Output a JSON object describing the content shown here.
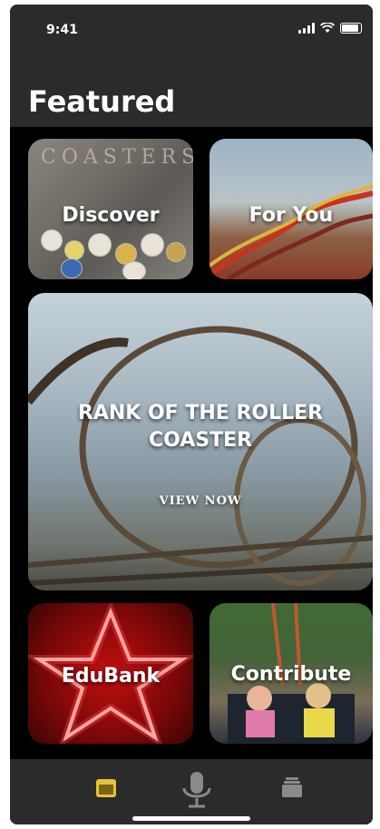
{
  "status_bar": {
    "time": "9:41"
  },
  "header": {
    "title": "Featured"
  },
  "tiles": {
    "discover": {
      "label": "Discover",
      "background_word": "COASTERS"
    },
    "for_you": {
      "label": "For You"
    },
    "rank": {
      "title": "RANK OF THE ROLLER COASTER",
      "cta": "VIEW NOW"
    },
    "edubank": {
      "label": "EduBank"
    },
    "contribute": {
      "label": "Contribute"
    }
  },
  "tab_bar": {
    "items": [
      {
        "icon": "featured-icon",
        "active": true,
        "color": "#e6c23a"
      },
      {
        "icon": "microphone-icon",
        "active": false,
        "color": "#8a8a8a"
      },
      {
        "icon": "library-icon",
        "active": false,
        "color": "#8a8a8a"
      }
    ]
  },
  "colors": {
    "background": "#000000",
    "bar": "#2b2b2b",
    "accent": "#e6c23a"
  }
}
